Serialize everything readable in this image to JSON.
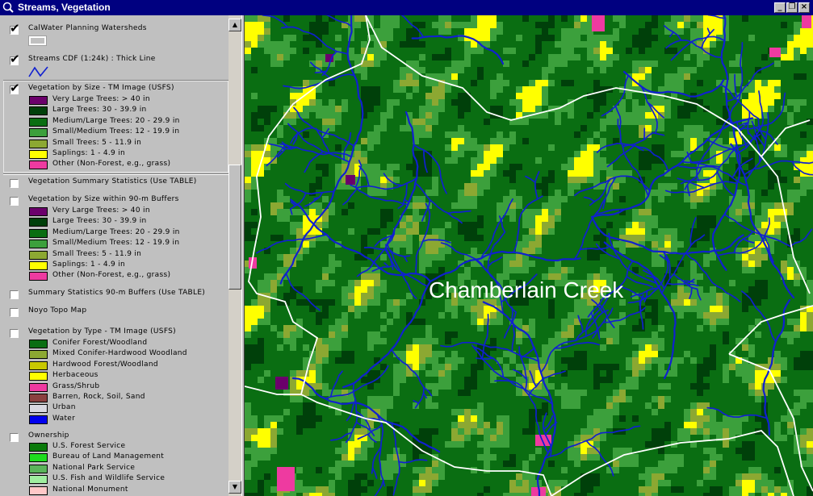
{
  "window": {
    "title": "Streams, Vegetation",
    "controls": {
      "minimize": "_",
      "restore": "❐",
      "close": "×"
    },
    "scroll_up": "▲",
    "scroll_down": "▼"
  },
  "toc": {
    "layers": [
      {
        "name": "CalWater Planning Watersheds",
        "checked": true,
        "legend_text": ""
      },
      {
        "name": "Streams CDF (1:24k) : Thick Line",
        "checked": true
      },
      {
        "name": "Vegetation by Size - TM Image (USFS)",
        "checked": true,
        "classes": [
          {
            "label": "Very Large Trees: > 40  in",
            "color": "#6b006b"
          },
          {
            "label": "Large Trees: 30 - 39.9 in",
            "color": "#00400a"
          },
          {
            "label": "Medium/Large Trees: 20 - 29.9 in",
            "color": "#0a6e12"
          },
          {
            "label": "Small/Medium Trees: 12 - 19.9 in",
            "color": "#3ca03c"
          },
          {
            "label": "Small Trees: 5 - 11.9 in",
            "color": "#8ca832"
          },
          {
            "label": "Saplings: 1 - 4.9 in",
            "color": "#ffff00"
          },
          {
            "label": "Other (Non-Forest, e.g., grass)",
            "color": "#ee3aa0"
          }
        ]
      },
      {
        "name": "Vegetation Summary Statistics (Use TABLE)",
        "checked": false
      },
      {
        "name": "Vegetation by Size within 90-m Buffers",
        "checked": false,
        "classes": [
          {
            "label": "Very Large Trees: > 40  in",
            "color": "#6b006b"
          },
          {
            "label": "Large Trees: 30 - 39.9 in",
            "color": "#00400a"
          },
          {
            "label": "Medium/Large Trees: 20 - 29.9 in",
            "color": "#0a6e12"
          },
          {
            "label": "Small/Medium Trees: 12 - 19.9 in",
            "color": "#3ca03c"
          },
          {
            "label": "Small Trees: 5 - 11.9 in",
            "color": "#8ca832"
          },
          {
            "label": "Saplings: 1 - 4.9 in",
            "color": "#ffff00"
          },
          {
            "label": "Other (Non-Forest, e.g., grass)",
            "color": "#ee3aa0"
          }
        ]
      },
      {
        "name": "Summary Statistics 90-m Buffers (Use TABLE)",
        "checked": false
      },
      {
        "name": "Noyo Topo Map",
        "checked": false
      },
      {
        "name": "Vegetation by Type - TM Image (USFS)",
        "checked": false,
        "classes": [
          {
            "label": "Conifer Forest/Woodland",
            "color": "#0a6e12"
          },
          {
            "label": "Mixed Conifer-Hardwood Woodland",
            "color": "#8ca832"
          },
          {
            "label": "Hardwood Forest/Woodland",
            "color": "#c8c800"
          },
          {
            "label": "Herbaceous",
            "color": "#ffff00"
          },
          {
            "label": "Grass/Shrub",
            "color": "#ee3aa0"
          },
          {
            "label": "Barren, Rock, Soil, Sand",
            "color": "#8b4040"
          },
          {
            "label": "Urban",
            "color": "#d8d8e0"
          },
          {
            "label": "Water",
            "color": "#0000ee"
          }
        ]
      },
      {
        "name": "Ownership",
        "checked": false,
        "classes": [
          {
            "label": "U.S. Forest Service",
            "color": "#0a7a0a"
          },
          {
            "label": "Bureau of Land Management",
            "color": "#1edc1e"
          },
          {
            "label": "National Park Service",
            "color": "#5ab45a"
          },
          {
            "label": "U.S. Fish and Wildlife Service",
            "color": "#a0eea0"
          },
          {
            "label": "National Monument",
            "color": "#ffc8c8"
          }
        ]
      }
    ]
  },
  "map": {
    "label": "Chamberlain Creek",
    "colors": {
      "base": "#0a6e12",
      "dark": "#00400a",
      "medium": "#3ca03c",
      "olive": "#8ca832",
      "yellow": "#ffff00",
      "magenta": "#ee3aa0",
      "purple": "#6b006b",
      "stream": "#1020d0",
      "boundary": "#ffffff"
    }
  }
}
